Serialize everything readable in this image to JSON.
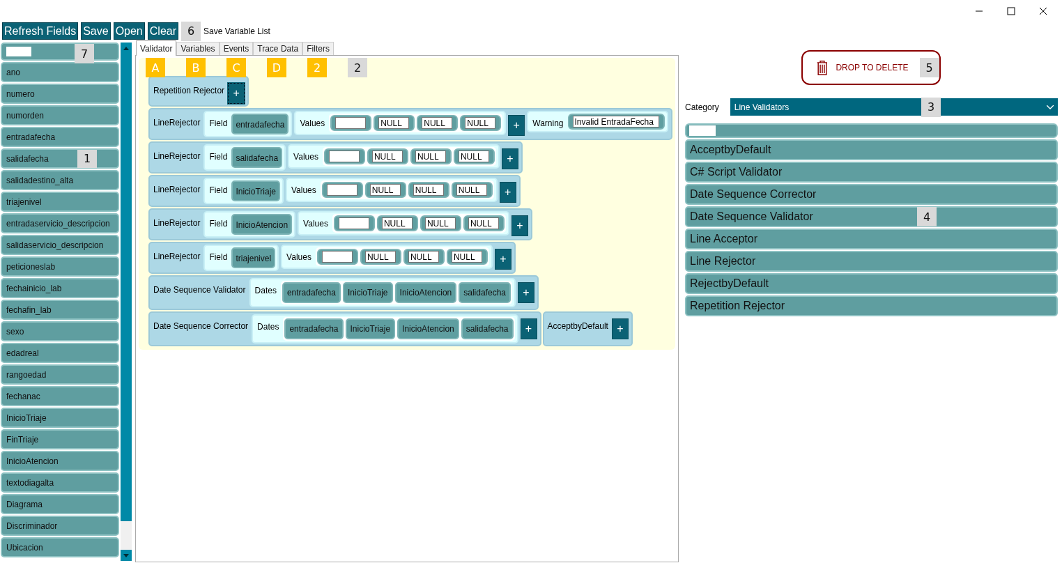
{
  "window": {
    "controls": [
      {
        "kind": "minimize"
      },
      {
        "kind": "maximize"
      },
      {
        "kind": "close"
      }
    ]
  },
  "toolbar": {
    "buttons": [
      "Refresh Fields",
      "Save",
      "Open",
      "Clear"
    ],
    "annotation": {
      "label": "6",
      "kind": "gray"
    },
    "option_label": "Save Variable List"
  },
  "field_list": {
    "filter_annotation": {
      "label": "7",
      "kind": "gray"
    },
    "items": [
      {
        "label": "ano"
      },
      {
        "label": "numero"
      },
      {
        "label": "numorden"
      },
      {
        "label": "entradafecha"
      },
      {
        "label": "salidafecha",
        "annotation": {
          "label": "1",
          "kind": "gray"
        }
      },
      {
        "label": "salidadestino_alta"
      },
      {
        "label": "triajenivel"
      },
      {
        "label": "entradaservicio_descripcion"
      },
      {
        "label": "salidaservicio_descripcion"
      },
      {
        "label": "peticioneslab"
      },
      {
        "label": "fechainicio_lab"
      },
      {
        "label": "fechafin_lab"
      },
      {
        "label": "sexo"
      },
      {
        "label": "edadreal"
      },
      {
        "label": "rangoedad"
      },
      {
        "label": "fechanac"
      },
      {
        "label": "InicioTriaje"
      },
      {
        "label": "FinTriaje"
      },
      {
        "label": "InicioAtencion"
      },
      {
        "label": "textodiagalta"
      },
      {
        "label": "Diagrama"
      },
      {
        "label": "Discriminador"
      },
      {
        "label": "Ubicacion"
      }
    ]
  },
  "tabs": [
    {
      "label": "Validator",
      "selected": true
    },
    {
      "label": "Variables",
      "selected": false
    },
    {
      "label": "Events",
      "selected": false
    },
    {
      "label": "Trace Data",
      "selected": false
    },
    {
      "label": "Filters",
      "selected": false
    }
  ],
  "validator": {
    "annotations": [
      {
        "label": "A",
        "kind": "yellow"
      },
      {
        "label": "B",
        "kind": "yellow"
      },
      {
        "label": "C",
        "kind": "yellow"
      },
      {
        "label": "D",
        "kind": "yellow"
      },
      {
        "label": "2",
        "kind": "yellow"
      },
      {
        "label": "2",
        "kind": "gray"
      }
    ],
    "rows": [
      {
        "blocks": [
          {
            "kind": "simple",
            "name": "Repetition Rejector",
            "add": "+"
          }
        ]
      },
      {
        "blocks": [
          {
            "kind": "line_rejector",
            "name": "LineRejector",
            "field_label": "Field",
            "field": "entradafecha",
            "values_label": "Values",
            "values": [
              {
                "kind": "empty"
              },
              {
                "kind": "text",
                "value": "NULL"
              },
              {
                "kind": "text",
                "value": "NULL"
              },
              {
                "kind": "text",
                "value": "NULL"
              }
            ],
            "add": "+",
            "warning_label": "Warning",
            "warning": "Invalid EntradaFecha"
          }
        ]
      },
      {
        "blocks": [
          {
            "kind": "line_rejector",
            "name": "LineRejector",
            "field_label": "Field",
            "field": "salidafecha",
            "values_label": "Values",
            "values": [
              {
                "kind": "empty"
              },
              {
                "kind": "text",
                "value": "NULL"
              },
              {
                "kind": "text",
                "value": "NULL"
              },
              {
                "kind": "text",
                "value": "NULL"
              }
            ],
            "add": "+"
          }
        ]
      },
      {
        "blocks": [
          {
            "kind": "line_rejector",
            "name": "LineRejector",
            "field_label": "Field",
            "field": "InicioTriaje",
            "values_label": "Values",
            "values": [
              {
                "kind": "empty"
              },
              {
                "kind": "text",
                "value": "NULL"
              },
              {
                "kind": "text",
                "value": "NULL"
              },
              {
                "kind": "text",
                "value": "NULL"
              }
            ],
            "add": "+"
          }
        ]
      },
      {
        "blocks": [
          {
            "kind": "line_rejector",
            "name": "LineRejector",
            "field_label": "Field",
            "field": "InicioAtencion",
            "values_label": "Values",
            "values": [
              {
                "kind": "empty"
              },
              {
                "kind": "text",
                "value": "NULL"
              },
              {
                "kind": "text",
                "value": "NULL"
              },
              {
                "kind": "text",
                "value": "NULL"
              }
            ],
            "add": "+"
          }
        ]
      },
      {
        "blocks": [
          {
            "kind": "line_rejector",
            "name": "LineRejector",
            "field_label": "Field",
            "field": "triajenivel",
            "values_label": "Values",
            "values": [
              {
                "kind": "empty"
              },
              {
                "kind": "text",
                "value": "NULL"
              },
              {
                "kind": "text",
                "value": "NULL"
              },
              {
                "kind": "text",
                "value": "NULL"
              }
            ],
            "add": "+"
          }
        ]
      },
      {
        "blocks": [
          {
            "kind": "date_sequence",
            "name": "Date Sequence Validator",
            "dates_label": "Dates",
            "dates": [
              "entradafecha",
              "InicioTriaje",
              "InicioAtencion",
              "salidafecha"
            ],
            "add": "+"
          }
        ]
      },
      {
        "blocks": [
          {
            "kind": "date_sequence",
            "name": "Date Sequence Corrector",
            "dates_label": "Dates",
            "dates": [
              "entradafecha",
              "InicioTriaje",
              "InicioAtencion",
              "salidafecha"
            ],
            "add": "+"
          },
          {
            "kind": "simple",
            "name": "AcceptbyDefault",
            "add": "+"
          }
        ]
      }
    ]
  },
  "right_panel": {
    "drop_zone": "DROP TO DELETE",
    "drop_annotation": {
      "label": "5",
      "kind": "gray"
    },
    "category_label": "Category",
    "category": "Line Validators",
    "category_annotation": {
      "label": "3",
      "kind": "gray"
    },
    "items": [
      {
        "label": "AcceptbyDefault"
      },
      {
        "label": "C# Script Validator"
      },
      {
        "label": "Date Sequence Corrector"
      },
      {
        "label": "Date Sequence Validator",
        "annotation": {
          "label": "4",
          "kind": "gray"
        }
      },
      {
        "label": "Line Acceptor"
      },
      {
        "label": "Line Rejector"
      },
      {
        "label": "RejectbyDefault"
      },
      {
        "label": "Repetition Rejector"
      }
    ]
  }
}
